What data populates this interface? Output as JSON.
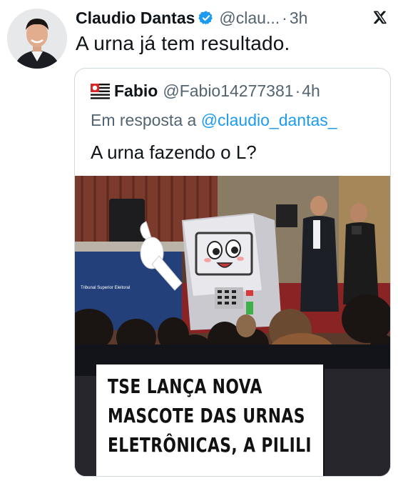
{
  "tweet": {
    "author_name": "Claudio Dantas",
    "author_handle": "@clau...",
    "separator": "·",
    "time": "3h",
    "text": "A urna já tem resultado."
  },
  "quoted": {
    "author_name": "Fabio",
    "author_handle": "@Fabio14277381",
    "separator": "·",
    "time": "4h",
    "reply_prefix": "Em resposta a",
    "reply_mention": "@claudio_dantas_",
    "text": "A urna fazendo o L?",
    "image": {
      "podium_text": "Tribunal Superior Eleitoral",
      "caption_lines": [
        "TSE LANÇA NOVA",
        "MASCOTE DAS URNAS",
        "ELETRÔNICAS, A PILILI"
      ]
    }
  },
  "icons": {
    "verified": "verified-badge-icon",
    "close": "x-logo-icon",
    "flag": "sao-paulo-flag-icon"
  },
  "colors": {
    "verified": "#1d9bf0",
    "link": "#1d9bf0",
    "secondary_text": "#536471",
    "border": "#cfd9de"
  }
}
